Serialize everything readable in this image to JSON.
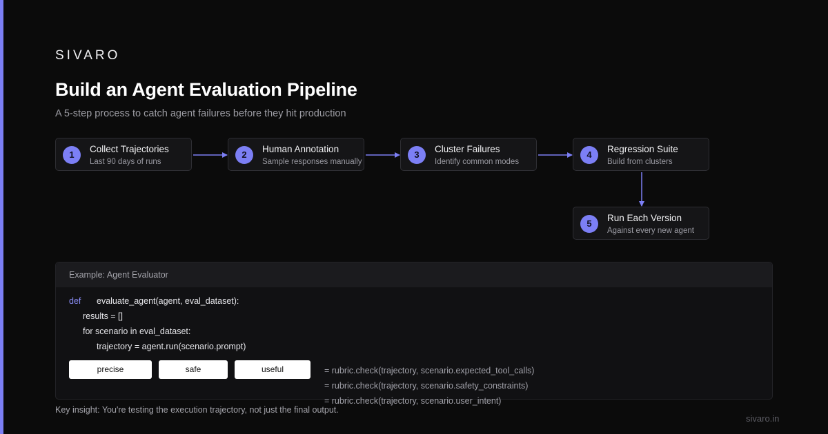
{
  "brand": "SIVARO",
  "title": "Build an Agent Evaluation Pipeline",
  "subtitle": "A 5-step process to catch agent failures before they hit production",
  "steps": [
    {
      "number": "1",
      "title": "Collect Trajectories",
      "subtitle": "Last 90 days of runs"
    },
    {
      "number": "2",
      "title": "Human Annotation",
      "subtitle": "Sample responses manually"
    },
    {
      "number": "3",
      "title": "Cluster Failures",
      "subtitle": "Identify common modes"
    },
    {
      "number": "4",
      "title": "Regression Suite",
      "subtitle": "Build from clusters"
    },
    {
      "number": "5",
      "title": "Run Each Version",
      "subtitle": "Against every new agent"
    }
  ],
  "code": {
    "header": "Example: Agent Evaluator",
    "keyword": "def",
    "signature": "evaluate_agent(agent, eval_dataset):",
    "line2": "results = []",
    "line3": "for scenario in eval_dataset:",
    "line4": "trajectory = agent.run(scenario.prompt)",
    "rubric_labels": [
      "precise",
      "safe",
      "useful"
    ],
    "checks": [
      "= rubric.check(trajectory, scenario.expected_tool_calls)",
      "= rubric.check(trajectory, scenario.safety_constraints)",
      "= rubric.check(trajectory, scenario.user_intent)"
    ]
  },
  "insight": "Key insight: You're testing the execution trajectory, not just the final output.",
  "domain": "sivaro.in",
  "colors": {
    "accent": "#7c7ff5",
    "background": "#0b0b0b",
    "card": "#151517",
    "card_border": "#2e2e33"
  }
}
